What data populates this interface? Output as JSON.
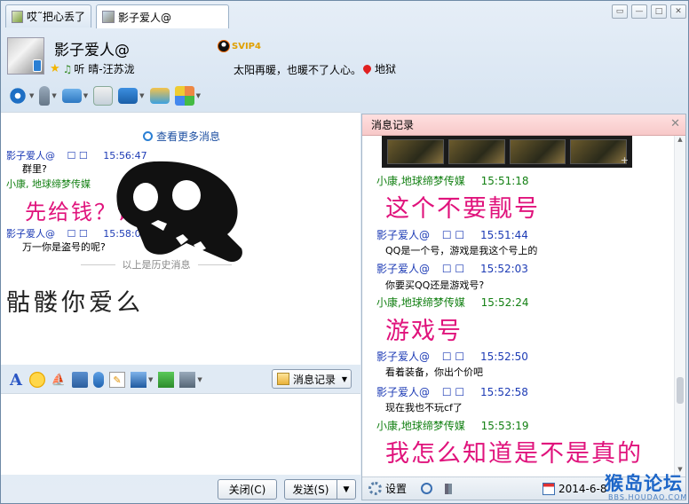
{
  "tabs": [
    {
      "label": "哎˜把心丢了"
    },
    {
      "label": "影子爱人@"
    }
  ],
  "window_buttons": [
    "▭",
    "—",
    "□",
    "✕"
  ],
  "contact": {
    "name": "影子爱人@",
    "vip_badge": "SVIP4",
    "music": "听 晴-汪苏泷",
    "signature": "太阳再暖，也暖不了人心。",
    "location": "地狱"
  },
  "chat": {
    "view_more": "查看更多消息",
    "messages": [
      {
        "sender": "影子爱人@",
        "extra": "☐ ☐",
        "time": "15:56:47",
        "text": "群里?"
      },
      {
        "sender": "小康, 地球缔梦传媒",
        "extra": "",
        "time": "15:57:01",
        "text": "先给钱？谁信啊"
      },
      {
        "sender": "影子爱人@",
        "extra": "☐ ☐",
        "time": "15:58:02",
        "text": "万一你是盗号的呢?"
      }
    ],
    "history_divider": "以上是历史消息",
    "handwriting": "骷髅你爱么"
  },
  "compose": {
    "history_button": "消息记录",
    "close_button": "关闭(C)",
    "send_button": "发送(S)",
    "send_arrow": "▼"
  },
  "history_panel": {
    "title": "消息记录",
    "close": "✕",
    "entries": [
      {
        "sender": "小康,地球缔梦传媒",
        "extra": "",
        "time": "15:51:18",
        "text": "这个不要靓号",
        "big": true
      },
      {
        "sender": "影子爱人@",
        "extra": "☐ ☐",
        "time": "15:51:44",
        "text": "QQ是一个号，游戏是我这个号上的",
        "big": false
      },
      {
        "sender": "影子爱人@",
        "extra": "☐ ☐",
        "time": "15:52:03",
        "text": "你要买QQ还是游戏号?",
        "big": false
      },
      {
        "sender": "小康,地球缔梦传媒",
        "extra": "",
        "time": "15:52:24",
        "text": "游戏号",
        "big": true
      },
      {
        "sender": "影子爱人@",
        "extra": "☐ ☐",
        "time": "15:52:50",
        "text": "看着装备，你出个价吧",
        "big": false
      },
      {
        "sender": "影子爱人@",
        "extra": "☐ ☐",
        "time": "15:52:58",
        "text": "现在我也不玩cf了",
        "big": false
      },
      {
        "sender": "小康,地球缔梦传媒",
        "extra": "",
        "time": "15:53:19",
        "text": "我怎么知道是不是真的",
        "big": true
      }
    ],
    "settings_label": "设置",
    "date": "2014-6-8"
  },
  "watermark": {
    "line1": "猴岛论坛",
    "line2": "BBS.HOUDAO.COM"
  },
  "colors": {
    "accent_blue": "#1d3bb5",
    "green_sender": "#138013",
    "big_pink": "#e0137c",
    "panel_title_bg": "#f7c9c9"
  },
  "icons": [
    "video-call-icon",
    "voice-call-icon",
    "send-file-icon",
    "add-contact-icon",
    "share-screen-icon",
    "remote-assist-icon",
    "apps-icon",
    "font-icon",
    "emoji-icon",
    "shake-icon",
    "video-msg-icon",
    "voice-msg-icon",
    "note-icon",
    "image-icon",
    "music-icon",
    "screenshot-icon"
  ]
}
